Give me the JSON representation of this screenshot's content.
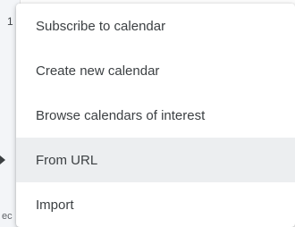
{
  "background": {
    "top_text": "1",
    "bottom_text": "ec"
  },
  "menu": {
    "items": [
      {
        "label": "Subscribe to calendar",
        "active": false
      },
      {
        "label": "Create new calendar",
        "active": false
      },
      {
        "label": "Browse calendars of interest",
        "active": false
      },
      {
        "label": "From URL",
        "active": true
      },
      {
        "label": "Import",
        "active": false
      }
    ]
  }
}
